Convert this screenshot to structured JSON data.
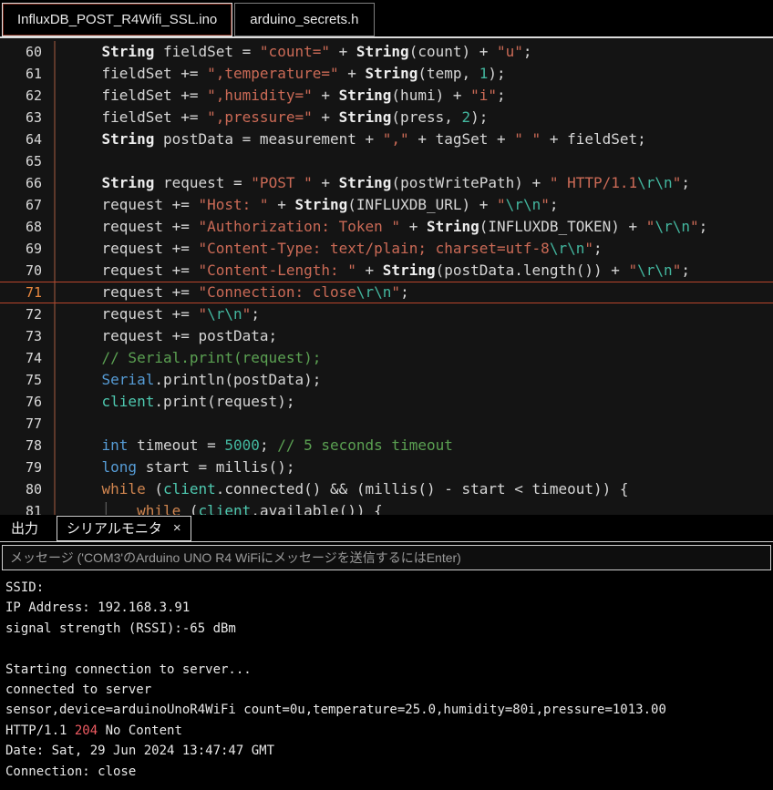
{
  "colors": {
    "accent_current_line": "#b8452b",
    "line_number_current": "#e8883f",
    "code_string": "#cb6a56",
    "code_escape": "#43b79f",
    "code_number": "#43b79f",
    "code_comment": "#5ba152",
    "code_keyword": "#569cd6",
    "code_control": "#d0854f",
    "code_class": "#4ec9b0",
    "code_serial": "#569cd6",
    "status_error": "#ef5b62",
    "panel_border": "#cfcfcf"
  },
  "editor_tabs": [
    {
      "label": "InfluxDB_POST_R4Wifi_SSL.ino",
      "active": true
    },
    {
      "label": "arduino_secrets.h",
      "active": false
    }
  ],
  "editor": {
    "current_line": 71,
    "lines": [
      {
        "num": 60,
        "tokens": [
          [
            "plain",
            "    "
          ],
          [
            "type",
            "String"
          ],
          [
            "plain",
            " fieldSet = "
          ],
          [
            "str",
            "\"count=\""
          ],
          [
            "plain",
            " + "
          ],
          [
            "type",
            "String"
          ],
          [
            "plain",
            "(count) + "
          ],
          [
            "str",
            "\"u\""
          ],
          [
            "plain",
            ";"
          ]
        ]
      },
      {
        "num": 61,
        "tokens": [
          [
            "plain",
            "    fieldSet += "
          ],
          [
            "str",
            "\",temperature=\""
          ],
          [
            "plain",
            " + "
          ],
          [
            "type",
            "String"
          ],
          [
            "plain",
            "(temp, "
          ],
          [
            "num",
            "1"
          ],
          [
            "plain",
            ");"
          ]
        ]
      },
      {
        "num": 62,
        "tokens": [
          [
            "plain",
            "    fieldSet += "
          ],
          [
            "str",
            "\",humidity=\""
          ],
          [
            "plain",
            " + "
          ],
          [
            "type",
            "String"
          ],
          [
            "plain",
            "(humi) + "
          ],
          [
            "str",
            "\"i\""
          ],
          [
            "plain",
            ";"
          ]
        ]
      },
      {
        "num": 63,
        "tokens": [
          [
            "plain",
            "    fieldSet += "
          ],
          [
            "str",
            "\",pressure=\""
          ],
          [
            "plain",
            " + "
          ],
          [
            "type",
            "String"
          ],
          [
            "plain",
            "(press, "
          ],
          [
            "num",
            "2"
          ],
          [
            "plain",
            ");"
          ]
        ]
      },
      {
        "num": 64,
        "tokens": [
          [
            "plain",
            "    "
          ],
          [
            "type",
            "String"
          ],
          [
            "plain",
            " postData = measurement + "
          ],
          [
            "str",
            "\",\""
          ],
          [
            "plain",
            " + tagSet + "
          ],
          [
            "str",
            "\" \""
          ],
          [
            "plain",
            " + fieldSet;"
          ]
        ]
      },
      {
        "num": 65,
        "tokens": []
      },
      {
        "num": 66,
        "tokens": [
          [
            "plain",
            "    "
          ],
          [
            "type",
            "String"
          ],
          [
            "plain",
            " request = "
          ],
          [
            "str",
            "\"POST \""
          ],
          [
            "plain",
            " + "
          ],
          [
            "type",
            "String"
          ],
          [
            "plain",
            "(postWritePath) + "
          ],
          [
            "str",
            "\" HTTP/1.1"
          ],
          [
            "esc",
            "\\r\\n"
          ],
          [
            "str",
            "\""
          ],
          [
            "plain",
            ";"
          ]
        ]
      },
      {
        "num": 67,
        "tokens": [
          [
            "plain",
            "    request += "
          ],
          [
            "str",
            "\"Host: \""
          ],
          [
            "plain",
            " + "
          ],
          [
            "type",
            "String"
          ],
          [
            "plain",
            "(INFLUXDB_URL) + "
          ],
          [
            "str",
            "\""
          ],
          [
            "esc",
            "\\r\\n"
          ],
          [
            "str",
            "\""
          ],
          [
            "plain",
            ";"
          ]
        ]
      },
      {
        "num": 68,
        "tokens": [
          [
            "plain",
            "    request += "
          ],
          [
            "str",
            "\"Authorization: Token \""
          ],
          [
            "plain",
            " + "
          ],
          [
            "type",
            "String"
          ],
          [
            "plain",
            "(INFLUXDB_TOKEN) + "
          ],
          [
            "str",
            "\""
          ],
          [
            "esc",
            "\\r\\n"
          ],
          [
            "str",
            "\""
          ],
          [
            "plain",
            ";"
          ]
        ]
      },
      {
        "num": 69,
        "tokens": [
          [
            "plain",
            "    request += "
          ],
          [
            "str",
            "\"Content-Type: text/plain; charset=utf-8"
          ],
          [
            "esc",
            "\\r\\n"
          ],
          [
            "str",
            "\""
          ],
          [
            "plain",
            ";"
          ]
        ]
      },
      {
        "num": 70,
        "tokens": [
          [
            "plain",
            "    request += "
          ],
          [
            "str",
            "\"Content-Length: \""
          ],
          [
            "plain",
            " + "
          ],
          [
            "type",
            "String"
          ],
          [
            "plain",
            "(postData.length()) + "
          ],
          [
            "str",
            "\""
          ],
          [
            "esc",
            "\\r\\n"
          ],
          [
            "str",
            "\""
          ],
          [
            "plain",
            ";"
          ]
        ]
      },
      {
        "num": 71,
        "tokens": [
          [
            "plain",
            "    request += "
          ],
          [
            "str",
            "\"Connection: close"
          ],
          [
            "esc",
            "\\r\\n"
          ],
          [
            "str",
            "\""
          ],
          [
            "plain",
            ";"
          ]
        ]
      },
      {
        "num": 72,
        "tokens": [
          [
            "plain",
            "    request += "
          ],
          [
            "str",
            "\""
          ],
          [
            "esc",
            "\\r\\n"
          ],
          [
            "str",
            "\""
          ],
          [
            "plain",
            ";"
          ]
        ]
      },
      {
        "num": 73,
        "tokens": [
          [
            "plain",
            "    request += postData;"
          ]
        ]
      },
      {
        "num": 74,
        "tokens": [
          [
            "plain",
            "    "
          ],
          [
            "comment",
            "// Serial.print(request);"
          ]
        ]
      },
      {
        "num": 75,
        "tokens": [
          [
            "plain",
            "    "
          ],
          [
            "serial",
            "Serial"
          ],
          [
            "plain",
            ".println(postData);"
          ]
        ]
      },
      {
        "num": 76,
        "tokens": [
          [
            "plain",
            "    "
          ],
          [
            "client",
            "client"
          ],
          [
            "plain",
            ".print(request);"
          ]
        ]
      },
      {
        "num": 77,
        "tokens": []
      },
      {
        "num": 78,
        "tokens": [
          [
            "plain",
            "    "
          ],
          [
            "kw",
            "int"
          ],
          [
            "plain",
            " timeout = "
          ],
          [
            "num",
            "5000"
          ],
          [
            "plain",
            "; "
          ],
          [
            "comment",
            "// 5 seconds timeout"
          ]
        ]
      },
      {
        "num": 79,
        "tokens": [
          [
            "plain",
            "    "
          ],
          [
            "kw",
            "long"
          ],
          [
            "plain",
            " start = millis();"
          ]
        ]
      },
      {
        "num": 80,
        "tokens": [
          [
            "plain",
            "    "
          ],
          [
            "ctrl",
            "while"
          ],
          [
            "plain",
            " ("
          ],
          [
            "client",
            "client"
          ],
          [
            "plain",
            ".connected() && (millis() - start < timeout)) {"
          ]
        ]
      },
      {
        "num": 81,
        "tokens": [
          [
            "plain",
            "    "
          ],
          [
            "guide",
            "│"
          ],
          [
            "plain",
            "   "
          ],
          [
            "ctrl",
            "while"
          ],
          [
            "plain",
            " ("
          ],
          [
            "client",
            "client"
          ],
          [
            "plain",
            ".available()) {"
          ]
        ]
      }
    ]
  },
  "bottom": {
    "output_tab": "出力",
    "serial_tab": "シリアルモニタ",
    "close_icon": "×",
    "message_placeholder": "メッセージ ('COM3'のArduino UNO R4 WiFiにメッセージを送信するにはEnter)"
  },
  "serial": {
    "lines": [
      [
        [
          "out",
          "SSID: "
        ]
      ],
      [
        [
          "out",
          "IP Address: 192.168.3.91"
        ]
      ],
      [
        [
          "out",
          "signal strength (RSSI):-65 dBm"
        ]
      ],
      [],
      [
        [
          "out",
          "Starting connection to server..."
        ]
      ],
      [
        [
          "out",
          "connected to server"
        ]
      ],
      [
        [
          "out",
          "sensor,device=arduinoUnoR4WiFi count=0u,temperature=25.0,humidity=80i,pressure=1013.00"
        ]
      ],
      [
        [
          "out",
          "HTTP/1.1 "
        ],
        [
          "status",
          "204"
        ],
        [
          "out",
          " No Content"
        ]
      ],
      [
        [
          "out",
          "Date: Sat, 29 Jun 2024 13:47:47 GMT"
        ]
      ],
      [
        [
          "out",
          "Connection: close"
        ]
      ]
    ]
  }
}
